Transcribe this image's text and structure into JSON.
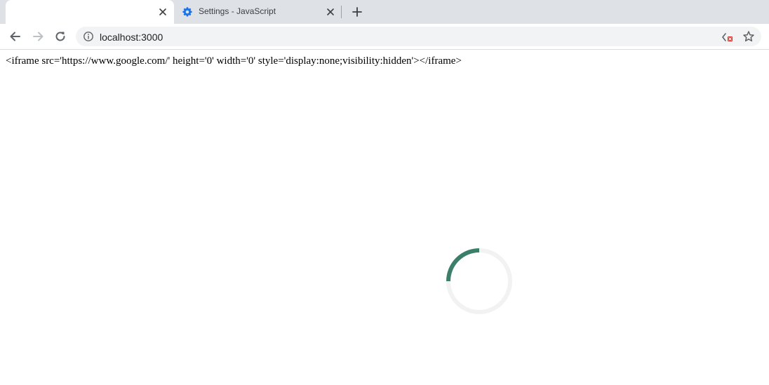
{
  "tabs": [
    {
      "title": "",
      "active": true,
      "close_icon": "close-icon"
    },
    {
      "title": "Settings - JavaScript",
      "active": false,
      "favicon": "gear-icon",
      "close_icon": "close-icon"
    }
  ],
  "toolbar": {
    "url": "localhost:3000",
    "icons": [
      "back-arrow-icon",
      "forward-arrow-icon",
      "reload-icon",
      "info-icon",
      "blocked-code-icon",
      "star-icon"
    ]
  },
  "page": {
    "content_text": "<iframe src='https://www.google.com/' height='0' width='0' style='display:none;visibility:hidden'></iframe>"
  },
  "colors": {
    "tabstrip_bg": "#dee1e6",
    "omnibox_bg": "#f1f3f4",
    "spinner_accent": "#3b7f6a",
    "spinner_track": "#f2f2f2",
    "favicon_blue": "#1a73e8"
  }
}
